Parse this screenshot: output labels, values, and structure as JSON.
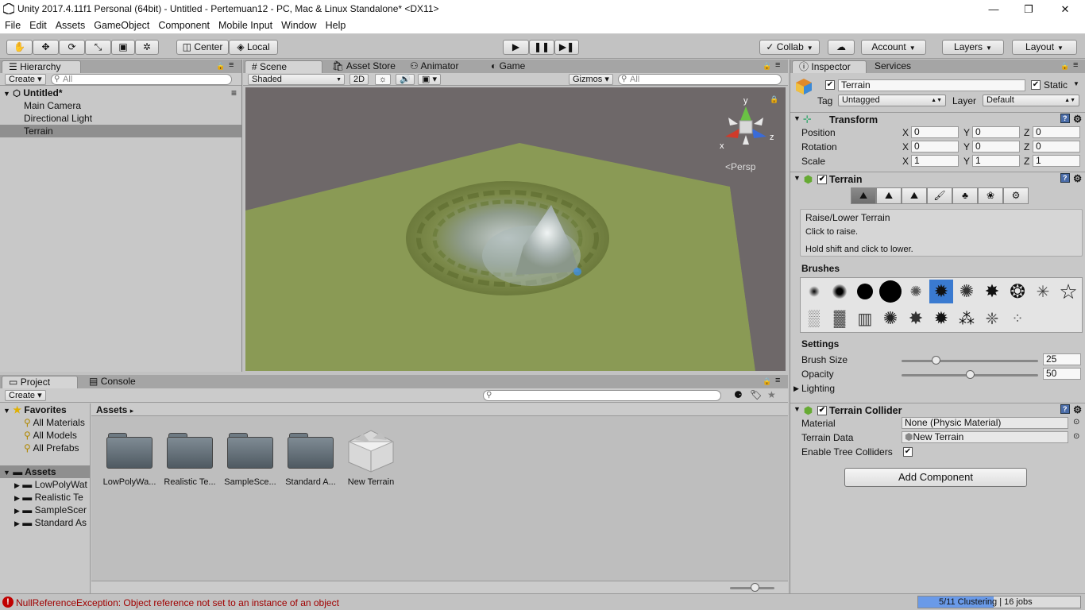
{
  "window": {
    "title": "Unity 2017.4.11f1 Personal (64bit) - Untitled - Pertemuan12 - PC, Mac & Linux Standalone* <DX11>"
  },
  "menu": [
    "File",
    "Edit",
    "Assets",
    "GameObject",
    "Component",
    "Mobile Input",
    "Window",
    "Help"
  ],
  "toolbar": {
    "center": "Center",
    "local": "Local",
    "collab": "Collab",
    "account": "Account",
    "layers": "Layers",
    "layout": "Layout"
  },
  "hierarchy": {
    "tab": "Hierarchy",
    "create": "Create",
    "search_placeholder": "All",
    "scene": "Untitled*",
    "items": [
      "Main Camera",
      "Directional Light",
      "Terrain"
    ]
  },
  "scene": {
    "tabs": [
      "Scene",
      "Asset Store",
      "Animator",
      "Game"
    ],
    "shading": "Shaded",
    "mode2d": "2D",
    "gizmos": "Gizmos",
    "search_placeholder": "All",
    "persp": "Persp",
    "axis_y": "y",
    "axis_x": "x",
    "axis_z": "z"
  },
  "project": {
    "tabs": [
      "Project",
      "Console"
    ],
    "create": "Create",
    "favorites": "Favorites",
    "fav_items": [
      "All Materials",
      "All Models",
      "All Prefabs"
    ],
    "assets_root": "Assets",
    "asset_tree": [
      "LowPolyWat",
      "Realistic Te",
      "SampleScer",
      "Standard As"
    ],
    "breadcrumb": "Assets",
    "grid": [
      "LowPolyWa...",
      "Realistic Te...",
      "SampleSce...",
      "Standard A...",
      "New Terrain"
    ]
  },
  "inspector": {
    "tabs": [
      "Inspector",
      "Services"
    ],
    "object_name": "Terrain",
    "static_label": "Static",
    "tag_label": "Tag",
    "tag_value": "Untagged",
    "layer_label": "Layer",
    "layer_value": "Default",
    "transform": {
      "title": "Transform",
      "position": "Position",
      "rotation": "Rotation",
      "scale": "Scale",
      "x": "X",
      "y": "Y",
      "z": "Z",
      "pos": [
        "0",
        "0",
        "0"
      ],
      "rot": [
        "0",
        "0",
        "0"
      ],
      "scl": [
        "1",
        "1",
        "1"
      ]
    },
    "terrain": {
      "title": "Terrain",
      "tool_title": "Raise/Lower Terrain",
      "tool_line1": "Click to raise.",
      "tool_line2": "Hold shift and click to lower.",
      "brushes": "Brushes",
      "settings": "Settings",
      "brush_size_label": "Brush Size",
      "brush_size": "25",
      "opacity_label": "Opacity",
      "opacity": "50",
      "lighting": "Lighting",
      "brush_size_fraction": 0.25,
      "opacity_fraction": 0.5
    },
    "collider": {
      "title": "Terrain Collider",
      "material_label": "Material",
      "material_value": "None (Physic Material)",
      "data_label": "Terrain Data",
      "data_value": "New Terrain",
      "trees_label": "Enable Tree Colliders"
    },
    "add_component": "Add Component"
  },
  "status": {
    "error": "NullReferenceException: Object reference not set to an instance of an object",
    "jobs": "5/11 Clustering | 16 jobs"
  },
  "colors": {
    "error": "#c00000",
    "progress": "#6a9ae8",
    "ground": "#8a9a55"
  }
}
